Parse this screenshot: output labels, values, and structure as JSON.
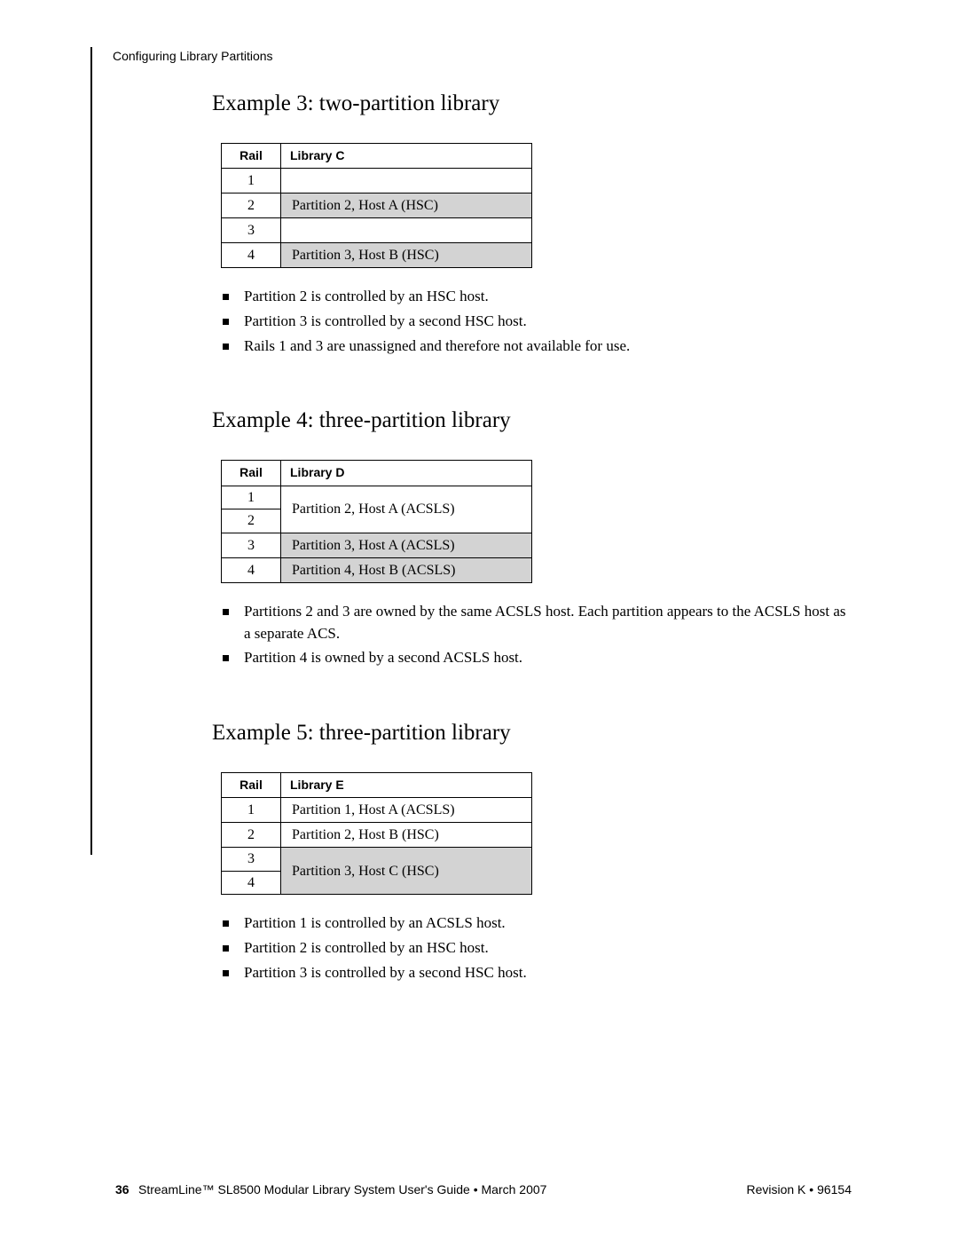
{
  "running_head": "Configuring Library Partitions",
  "sections": [
    {
      "heading": "Example 3: two-partition library",
      "table": {
        "rail_header": "Rail",
        "lib_header": "Library C",
        "rows": [
          {
            "rail": "1",
            "lib": "",
            "shade": false,
            "rowspan": 1
          },
          {
            "rail": "2",
            "lib": "Partition 2, Host A (HSC)",
            "shade": true,
            "rowspan": 1
          },
          {
            "rail": "3",
            "lib": "",
            "shade": false,
            "rowspan": 1
          },
          {
            "rail": "4",
            "lib": "Partition 3, Host B (HSC)",
            "shade": true,
            "rowspan": 1
          }
        ]
      },
      "bullets": [
        "Partition 2 is controlled by an HSC host.",
        "Partition 3 is controlled by a second HSC host.",
        "Rails 1 and 3 are unassigned and therefore not available for use."
      ]
    },
    {
      "heading": "Example 4: three-partition library",
      "table": {
        "rail_header": "Rail",
        "lib_header": "Library D",
        "rows": [
          {
            "rail": "1",
            "lib": "Partition 2, Host A (ACSLS)",
            "shade": false,
            "rowspan": 2
          },
          {
            "rail": "2",
            "lib": null,
            "shade": false,
            "rowspan": 0
          },
          {
            "rail": "3",
            "lib": "Partition 3, Host A (ACSLS)",
            "shade": true,
            "rowspan": 1
          },
          {
            "rail": "4",
            "lib": "Partition 4, Host B (ACSLS)",
            "shade": true,
            "rowspan": 1
          }
        ]
      },
      "bullets": [
        "Partitions 2 and 3 are owned by the same ACSLS host. Each partition appears to the ACSLS host as a separate ACS.",
        "Partition 4 is owned by a second ACSLS host."
      ]
    },
    {
      "heading": "Example 5: three-partition library",
      "table": {
        "rail_header": "Rail",
        "lib_header": "Library E",
        "rows": [
          {
            "rail": "1",
            "lib": "Partition 1, Host A (ACSLS)",
            "shade": false,
            "rowspan": 1
          },
          {
            "rail": "2",
            "lib": "Partition 2, Host B (HSC)",
            "shade": false,
            "rowspan": 1
          },
          {
            "rail": "3",
            "lib": "Partition 3, Host C (HSC)",
            "shade": true,
            "rowspan": 2
          },
          {
            "rail": "4",
            "lib": null,
            "shade": true,
            "rowspan": 0
          }
        ]
      },
      "bullets": [
        "Partition 1 is controlled by an ACSLS host.",
        "Partition 2 is controlled by an HSC host.",
        "Partition 3 is controlled by a second HSC host."
      ]
    }
  ],
  "footer": {
    "page_number": "36",
    "center": "StreamLine™ SL8500 Modular Library System User's Guide  •  March 2007",
    "right": "Revision K  •  96154"
  }
}
